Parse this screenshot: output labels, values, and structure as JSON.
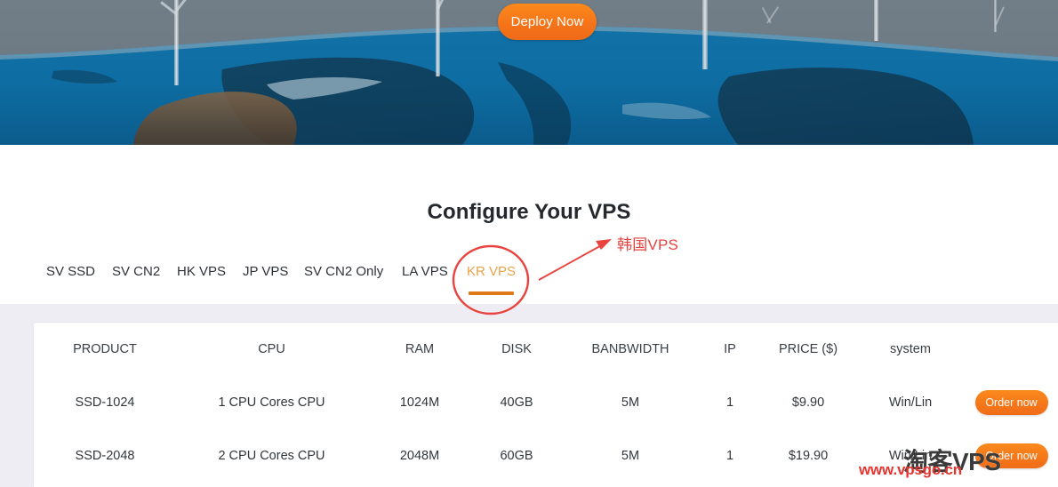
{
  "hero": {
    "deploy_button_label": "Deploy Now",
    "scene": "wind-turbines-on-blue-hillside",
    "colors": {
      "sky": "#6e7a84",
      "hill": "#0f6ea6",
      "accent_orange": "#f5761a"
    }
  },
  "section": {
    "title": "Configure Your VPS"
  },
  "tabs": [
    {
      "label": "SV SSD",
      "active": false
    },
    {
      "label": "SV CN2",
      "active": false
    },
    {
      "label": "HK VPS",
      "active": false
    },
    {
      "label": "JP VPS",
      "active": false
    },
    {
      "label": "SV CN2 Only",
      "active": false
    },
    {
      "label": "LA VPS",
      "active": false
    },
    {
      "label": "KR VPS",
      "active": true
    }
  ],
  "annotation": {
    "label": "韩国VPS",
    "color": "#e8433f",
    "target_tab": "KR VPS",
    "shape": "ellipse-with-arrow"
  },
  "table": {
    "headers": [
      "PRODUCT",
      "CPU",
      "RAM",
      "DISK",
      "BANBWIDTH",
      "IP",
      "PRICE ($)",
      "system",
      ""
    ],
    "rows": [
      {
        "product": "SSD-1024",
        "cpu": "1 CPU Cores CPU",
        "ram": "1024M",
        "disk": "40GB",
        "bandwidth": "5M",
        "ip": "1",
        "price": "$9.90",
        "system": "Win/Lin",
        "action": "Order now"
      },
      {
        "product": "SSD-2048",
        "cpu": "2 CPU Cores CPU",
        "ram": "2048M",
        "disk": "60GB",
        "bandwidth": "5M",
        "ip": "1",
        "price": "$19.90",
        "system": "Win/Lin",
        "action": "Order now"
      }
    ]
  },
  "watermark": {
    "main": "淘客VPS",
    "url": "www.vpsgo.cn"
  }
}
